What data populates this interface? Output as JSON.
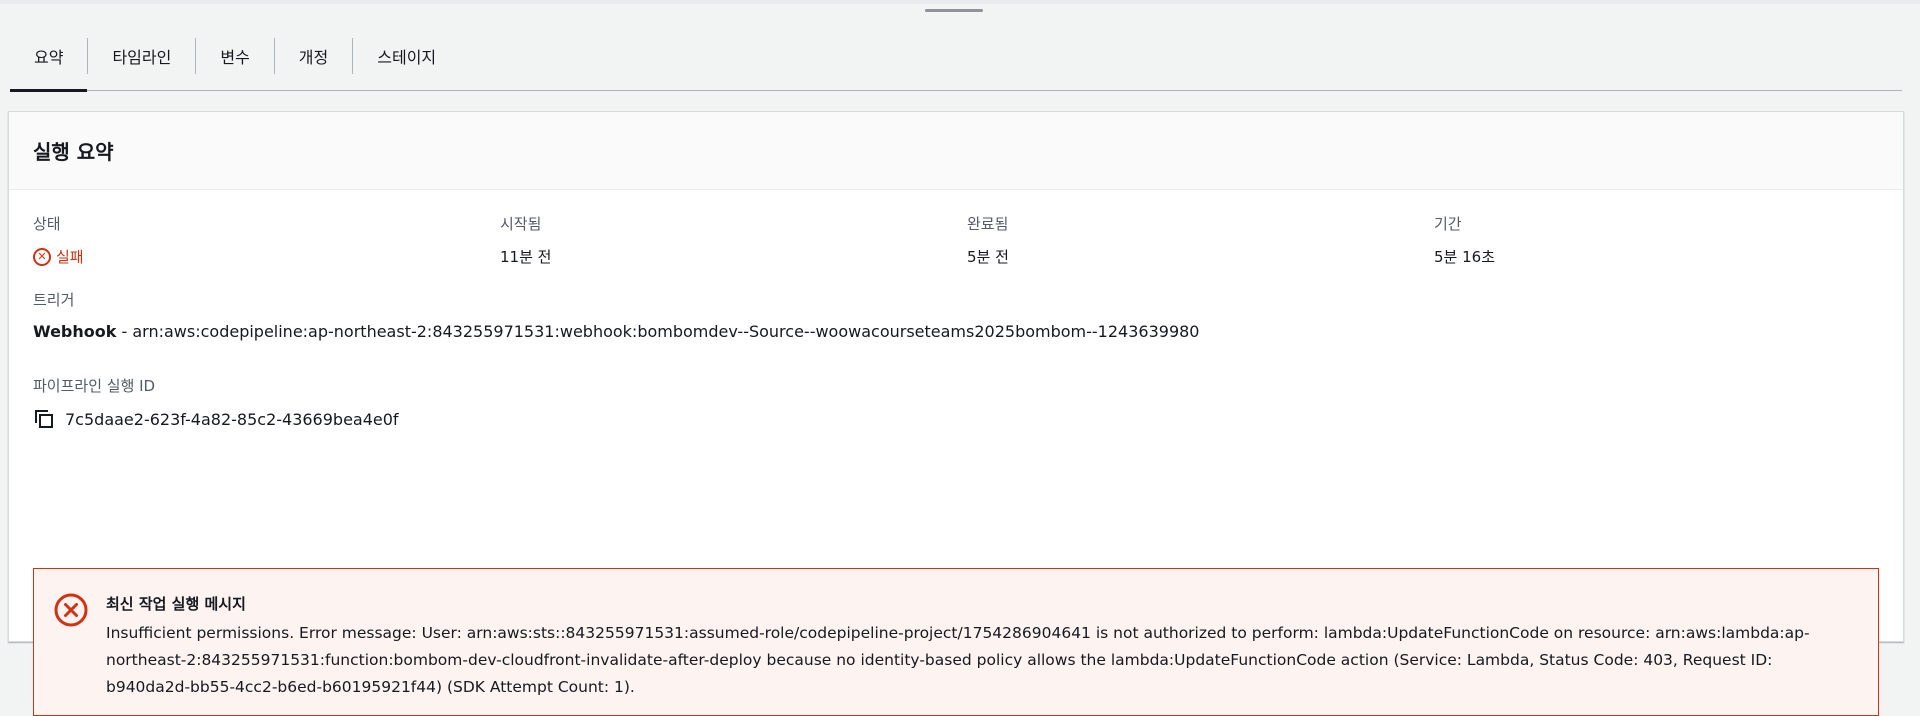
{
  "tabs": [
    {
      "label": "요약",
      "active": true
    },
    {
      "label": "타임라인"
    },
    {
      "label": "변수"
    },
    {
      "label": "개정"
    },
    {
      "label": "스테이지"
    }
  ],
  "summary": {
    "title": "실행 요약",
    "status_label": "상태",
    "status_value": "실패",
    "started_label": "시작됨",
    "started_value": "11분 전",
    "completed_label": "완료됨",
    "completed_value": "5분 전",
    "duration_label": "기간",
    "duration_value": "5분 16초",
    "trigger_label": "트리거",
    "trigger_type": "Webhook",
    "trigger_detail": " - arn:aws:codepipeline:ap-northeast-2:843255971531:webhook:bombomdev--Source--woowacourseteams2025bombom--1243639980",
    "execution_id_label": "파이프라인 실행 ID",
    "execution_id_value": "7c5daae2-623f-4a82-85c2-43669bea4e0f"
  },
  "alert": {
    "title": "최신 작업 실행 메시지",
    "message": "Insufficient permissions. Error message: User: arn:aws:sts::843255971531:assumed-role/codepipeline-project/1754286904641 is not authorized to perform: lambda:UpdateFunctionCode on resource: arn:aws:lambda:ap-northeast-2:843255971531:function:bombom-dev-cloudfront-invalidate-after-deploy because no identity-based policy allows the lambda:UpdateFunctionCode action (Service: Lambda, Status Code: 403, Request ID: b940da2d-bb55-4cc2-b6ed-b60195921f44) (SDK Attempt Count: 1)."
  },
  "colors": {
    "error": "#d13212",
    "error_bg": "#fdf3f1",
    "text": "#16191f",
    "label": "#545b64"
  },
  "icons": {
    "status": "x-circle-icon",
    "copy": "copy-icon",
    "alert": "error-circle-icon"
  }
}
